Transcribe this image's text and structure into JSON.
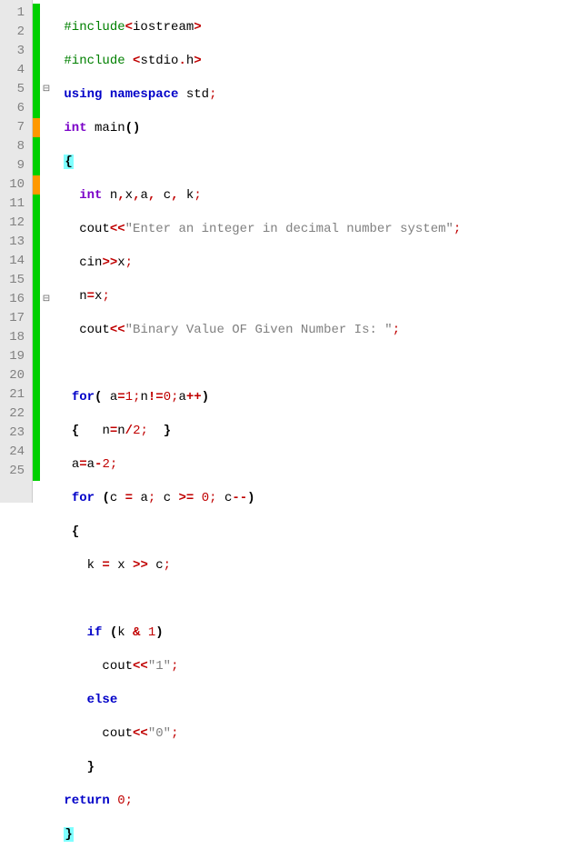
{
  "lines": [
    1,
    2,
    3,
    4,
    5,
    6,
    7,
    8,
    9,
    10,
    11,
    12,
    13,
    14,
    15,
    16,
    17,
    18,
    19,
    20,
    21,
    22,
    23,
    24,
    25
  ],
  "markers": [
    "green",
    "green",
    "green",
    "green",
    "green",
    "green",
    "orange",
    "green",
    "green",
    "orange",
    "green",
    "green",
    "green",
    "green",
    "green",
    "green",
    "green",
    "green",
    "green",
    "green",
    "green",
    "green",
    "green",
    "green",
    "green"
  ],
  "fold": [
    "",
    "",
    "",
    "",
    "-",
    "",
    "",
    "",
    "",
    "",
    "",
    "",
    "",
    "",
    "",
    "-",
    "",
    "",
    "",
    "",
    "",
    "",
    "",
    "",
    ""
  ],
  "code": {
    "l1": {
      "pp": "#include",
      "hdr": "<iostream>"
    },
    "l2": {
      "pp": "#include ",
      "hdr": "<stdio.h>"
    },
    "l3": {
      "kw1": "using",
      "kw2": "namespace",
      "id": "std"
    },
    "l4": {
      "kw": "int",
      "id": "main"
    },
    "l5": {
      "brace": "{"
    },
    "l6": {
      "kw": "int",
      "vars": "n,x,a, c, k"
    },
    "l7": {
      "id": "cout",
      "str": "\"Enter an integer in decimal number system\""
    },
    "l8": {
      "id": "cin",
      "var": "x"
    },
    "l9": {
      "a": "n",
      "b": "x"
    },
    "l10": {
      "id": "cout",
      "str": "\"Binary Value OF Given Number Is: \""
    },
    "l12": {
      "kw": "for",
      "a": "a",
      "n1": "1",
      "b": "n",
      "n0": "0",
      "c": "a"
    },
    "l13": {
      "a": "n",
      "b": "n",
      "n": "2"
    },
    "l14": {
      "a": "a",
      "b": "a",
      "n": "2"
    },
    "l15": {
      "kw": "for",
      "a": "c",
      "b": "a",
      "c": "c",
      "n": "0",
      "d": "c"
    },
    "l16": {
      "brace": "{"
    },
    "l17": {
      "a": "k",
      "b": "x",
      "c": "c"
    },
    "l19": {
      "kw": "if",
      "a": "k",
      "n": "1"
    },
    "l20": {
      "id": "cout",
      "str": "\"1\""
    },
    "l21": {
      "kw": "else"
    },
    "l22": {
      "id": "cout",
      "str": "\"0\""
    },
    "l23": {
      "brace": "}"
    },
    "l24": {
      "kw": "return",
      "n": "0"
    },
    "l25": {
      "brace": "}"
    }
  }
}
